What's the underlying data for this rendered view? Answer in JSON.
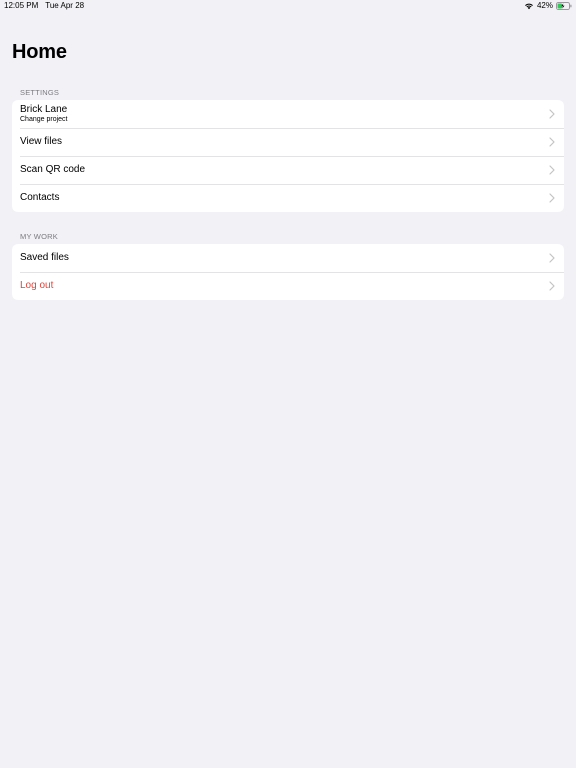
{
  "status_bar": {
    "time": "12:05 PM",
    "date": "Tue Apr 28",
    "battery_percent": "42%",
    "battery_level": 0.42,
    "charging": true
  },
  "title": "Home",
  "sections": {
    "settings": {
      "header": "SETTINGS",
      "rows": [
        {
          "label": "Brick Lane",
          "sublabel": "Change project"
        },
        {
          "label": "View files"
        },
        {
          "label": "Scan QR code"
        },
        {
          "label": "Contacts"
        }
      ]
    },
    "my_work": {
      "header": "MY WORK",
      "rows": [
        {
          "label": "Saved files"
        },
        {
          "label": "Log out"
        }
      ]
    }
  },
  "colors": {
    "background": "#f2f1f6",
    "destructive": "#e0443a",
    "battery_fill": "#34c759",
    "chevron": "#c4c4c7"
  }
}
